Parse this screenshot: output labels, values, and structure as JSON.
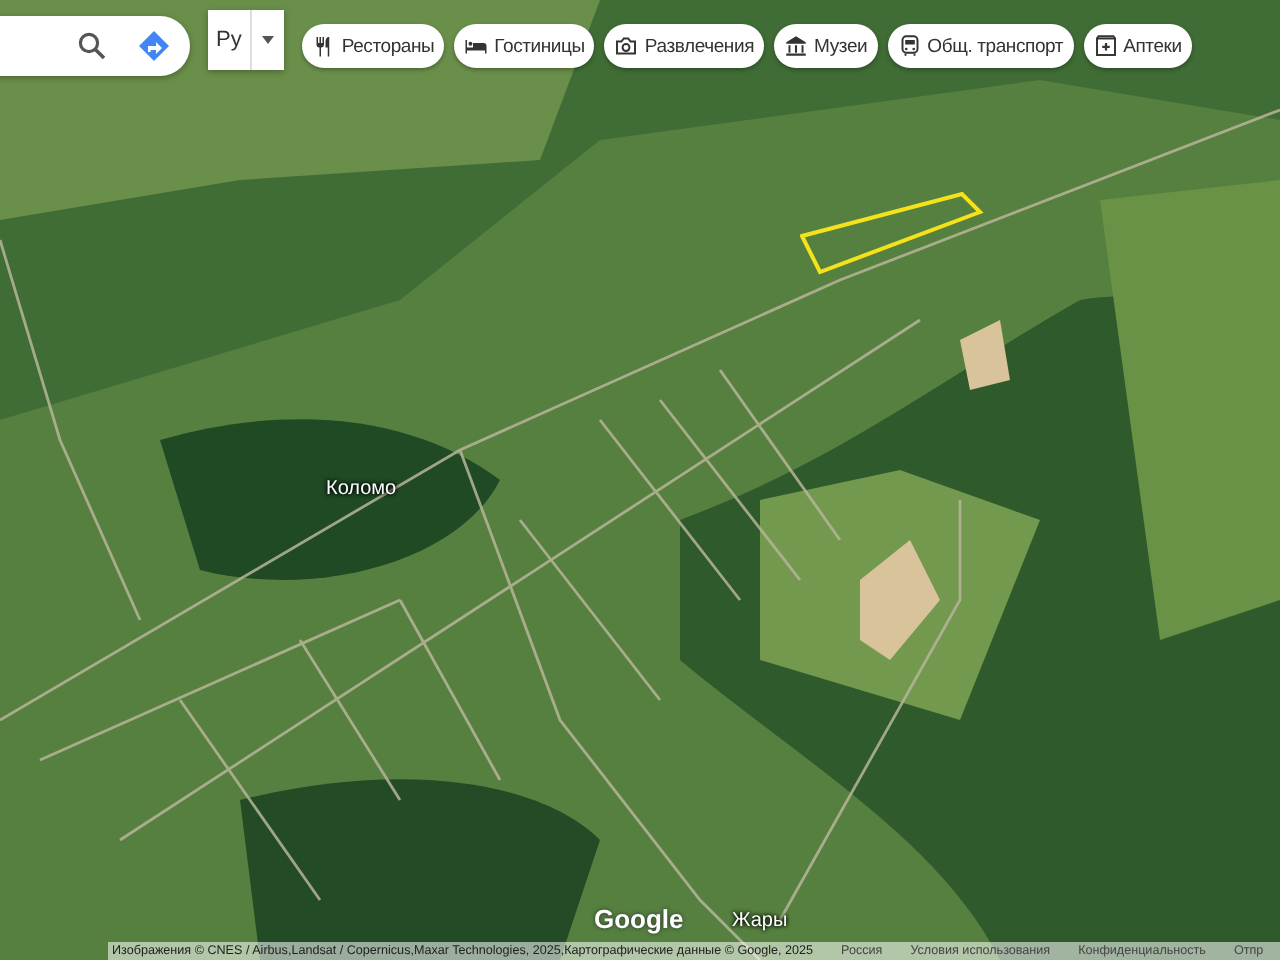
{
  "search": {
    "language": "Ру"
  },
  "chips": [
    {
      "label": "Рестораны"
    },
    {
      "label": "Гостиницы"
    },
    {
      "label": "Развлечения"
    },
    {
      "label": "Музеи"
    },
    {
      "label": "Общ. транспорт"
    },
    {
      "label": "Аптеки"
    }
  ],
  "map": {
    "places": [
      {
        "name": "Коломо"
      },
      {
        "name": "Жары"
      }
    ],
    "logo": "Google"
  },
  "attribution": {
    "text": "Изображения © CNES / Airbus,Landsat / Copernicus,Maxar Technologies, 2025,Картографические данные © Google, 2025",
    "links": [
      "Россия",
      "Условия использования",
      "Конфиденциальность",
      "Отпр"
    ]
  }
}
